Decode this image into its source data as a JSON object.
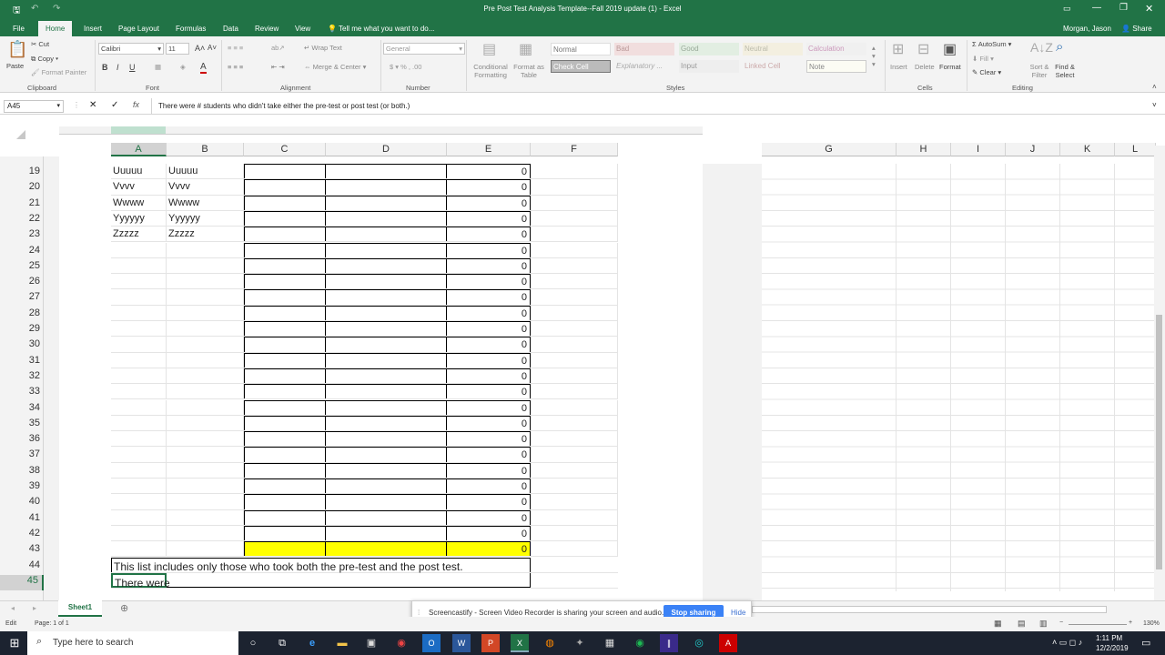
{
  "window": {
    "title": "Pre Post Test Analysis Template--Fall 2019 update (1) - Excel",
    "user": "Morgan, Jason",
    "share": "Share"
  },
  "menu": {
    "tabs": [
      "File",
      "Home",
      "Insert",
      "Page Layout",
      "Formulas",
      "Data",
      "Review",
      "View"
    ],
    "tell_me": "Tell me what you want to do..."
  },
  "ribbon": {
    "clipboard": {
      "paste": "Paste",
      "cut": "Cut",
      "copy": "Copy",
      "format_painter": "Format Painter",
      "label": "Clipboard"
    },
    "font": {
      "name": "Calibri",
      "size": "11",
      "label": "Font"
    },
    "alignment": {
      "wrap": "Wrap Text",
      "merge": "Merge & Center",
      "label": "Alignment"
    },
    "number": {
      "format": "General",
      "label": "Number"
    },
    "styles": {
      "cond": "Conditional Formatting",
      "table": "Format as Table",
      "normal": "Normal",
      "bad": "Bad",
      "good": "Good",
      "neutral": "Neutral",
      "calculation": "Calculation",
      "check": "Check Cell",
      "explanatory": "Explanatory ...",
      "input": "Input",
      "linked": "Linked Cell",
      "note": "Note",
      "label": "Styles"
    },
    "cells": {
      "insert": "Insert",
      "delete": "Delete",
      "format": "Format",
      "label": "Cells"
    },
    "editing": {
      "autosum": "AutoSum",
      "fill": "Fill",
      "clear": "Clear",
      "sort": "Sort & Filter",
      "find": "Find & Select",
      "label": "Editing"
    },
    "colors": {
      "bad": "#ffc7ce",
      "good": "#c6efce",
      "neutral": "#ffeb9c",
      "check": "#a5a5a5"
    }
  },
  "formula_bar": {
    "name_box": "A45",
    "content": "There were # students who didn't take either the pre-test or post test (or both.)"
  },
  "columns_left": [
    "A",
    "B",
    "C",
    "D",
    "E",
    "F"
  ],
  "columns_right": [
    "G",
    "H",
    "I",
    "J",
    "K",
    "L"
  ],
  "rows": [
    {
      "n": "19",
      "a": "Uuuuu",
      "b": "Uuuuu",
      "e": "0"
    },
    {
      "n": "20",
      "a": "Vvvv",
      "b": "Vvvv",
      "e": "0"
    },
    {
      "n": "21",
      "a": "Wwww",
      "b": "Wwww",
      "e": "0"
    },
    {
      "n": "22",
      "a": "Yyyyyy",
      "b": "Yyyyyy",
      "e": "0"
    },
    {
      "n": "23",
      "a": "Zzzzz",
      "b": "Zzzzz",
      "e": "0"
    },
    {
      "n": "24",
      "a": "",
      "b": "",
      "e": "0"
    },
    {
      "n": "25",
      "a": "",
      "b": "",
      "e": "0"
    },
    {
      "n": "26",
      "a": "",
      "b": "",
      "e": "0"
    },
    {
      "n": "27",
      "a": "",
      "b": "",
      "e": "0"
    },
    {
      "n": "28",
      "a": "",
      "b": "",
      "e": "0"
    },
    {
      "n": "29",
      "a": "",
      "b": "",
      "e": "0"
    },
    {
      "n": "30",
      "a": "",
      "b": "",
      "e": "0"
    },
    {
      "n": "31",
      "a": "",
      "b": "",
      "e": "0"
    },
    {
      "n": "32",
      "a": "",
      "b": "",
      "e": "0"
    },
    {
      "n": "33",
      "a": "",
      "b": "",
      "e": "0"
    },
    {
      "n": "34",
      "a": "",
      "b": "",
      "e": "0"
    },
    {
      "n": "35",
      "a": "",
      "b": "",
      "e": "0"
    },
    {
      "n": "36",
      "a": "",
      "b": "",
      "e": "0"
    },
    {
      "n": "37",
      "a": "",
      "b": "",
      "e": "0"
    },
    {
      "n": "38",
      "a": "",
      "b": "",
      "e": "0"
    },
    {
      "n": "39",
      "a": "",
      "b": "",
      "e": "0"
    },
    {
      "n": "40",
      "a": "",
      "b": "",
      "e": "0"
    },
    {
      "n": "41",
      "a": "",
      "b": "",
      "e": "0"
    },
    {
      "n": "42",
      "a": "",
      "b": "",
      "e": "0"
    },
    {
      "n": "43",
      "a": "",
      "b": "",
      "e": "0",
      "highlight": "#ffff00"
    },
    {
      "n": "44",
      "a": "This list includes only those who took both the pre-test and the post test.",
      "b": "",
      "e": ""
    },
    {
      "n": "45",
      "a": "There were",
      "b": "",
      "e": "",
      "active": true
    }
  ],
  "sheet_tab": "Sheet1",
  "status": {
    "mode": "Edit",
    "page": "Page: 1 of 1",
    "zoom": "130%"
  },
  "toast": {
    "text": "Screencastify - Screen Video Recorder is sharing your screen and audio.",
    "stop": "Stop sharing",
    "hide": "Hide"
  },
  "taskbar": {
    "search": "Type here to search",
    "time": "1:11 PM",
    "date": "12/2/2019"
  }
}
